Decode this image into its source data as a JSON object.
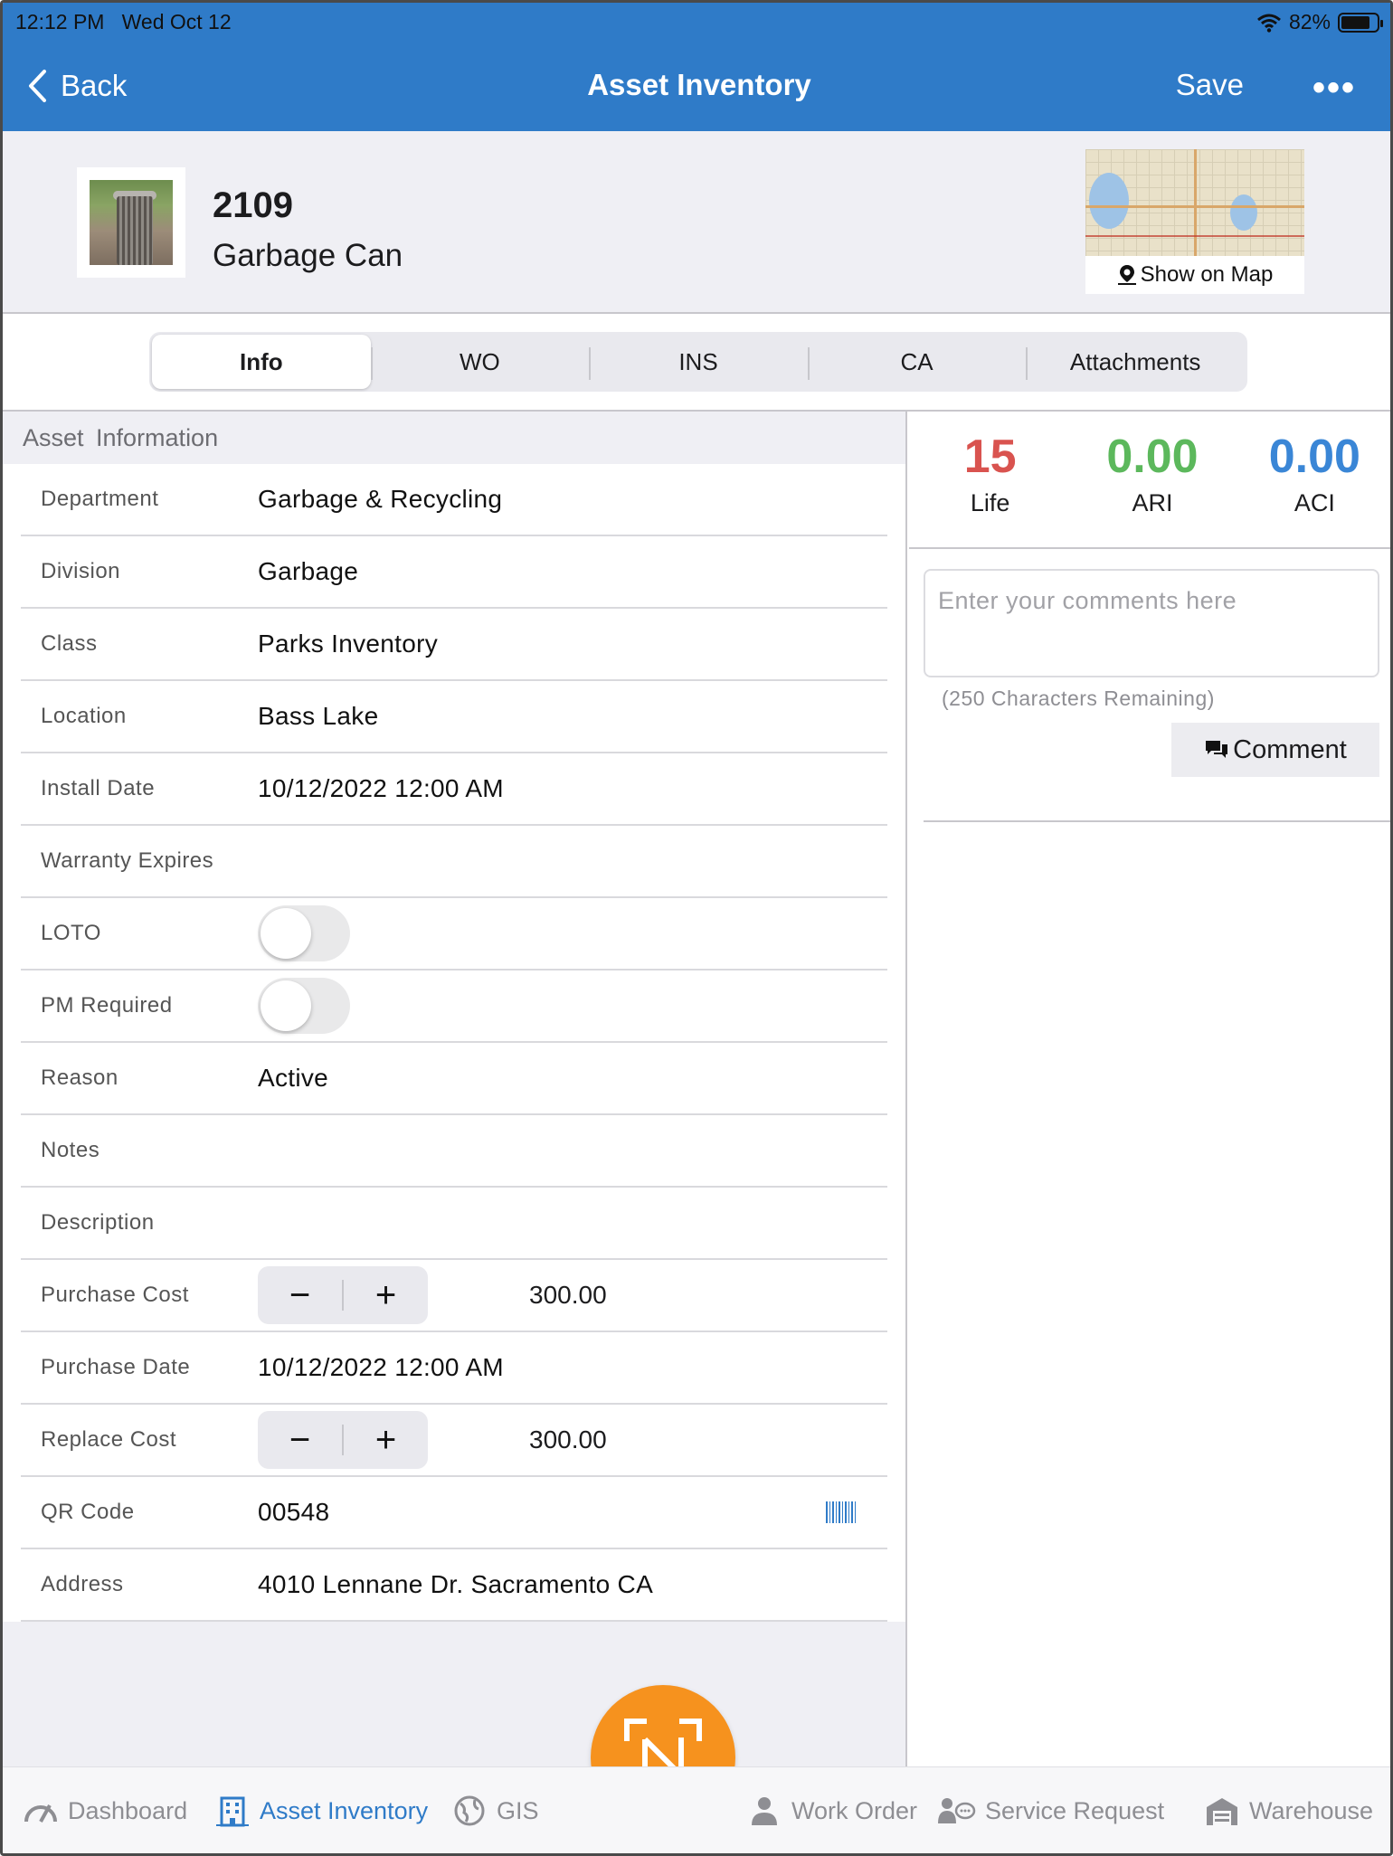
{
  "status_bar": {
    "time": "12:12 PM",
    "date": "Wed Oct 12",
    "battery": "82%",
    "battery_level": 0.82
  },
  "nav": {
    "back_label": "Back",
    "title": "Asset Inventory",
    "save_label": "Save",
    "more_label": "•••"
  },
  "asset": {
    "id": "2109",
    "name": "Garbage Can",
    "map_label": "Show on Map"
  },
  "tabs": [
    {
      "label": "Info",
      "active": true
    },
    {
      "label": "WO"
    },
    {
      "label": "INS"
    },
    {
      "label": "CA"
    },
    {
      "label": "Attachments"
    }
  ],
  "section_title": "Asset Information",
  "fields": {
    "department": {
      "label": "Department",
      "value": "Garbage & Recycling"
    },
    "division": {
      "label": "Division",
      "value": "Garbage"
    },
    "class": {
      "label": "Class",
      "value": "Parks Inventory"
    },
    "location": {
      "label": "Location",
      "value": "Bass Lake"
    },
    "install_date": {
      "label": "Install Date",
      "value": "10/12/2022 12:00 AM"
    },
    "warranty": {
      "label": "Warranty Expires",
      "value": ""
    },
    "loto": {
      "label": "LOTO",
      "on": false
    },
    "pm_required": {
      "label": "PM Required",
      "on": false
    },
    "reason": {
      "label": "Reason",
      "value": "Active"
    },
    "notes": {
      "label": "Notes",
      "value": ""
    },
    "description": {
      "label": "Description",
      "value": ""
    },
    "purchase_cost": {
      "label": "Purchase Cost",
      "value": "300.00",
      "minus": "−",
      "plus": "+"
    },
    "purchase_date": {
      "label": "Purchase Date",
      "value": "10/12/2022 12:00 AM"
    },
    "replace_cost": {
      "label": "Replace Cost",
      "value": "300.00",
      "minus": "−",
      "plus": "+"
    },
    "qr_code": {
      "label": "QR Code",
      "value": "00548"
    },
    "address": {
      "label": "Address",
      "value": "4010 Lennane Dr. Sacramento CA"
    }
  },
  "stats": [
    {
      "value": "15",
      "label": "Life",
      "color": "#d9534f"
    },
    {
      "value": "0.00",
      "label": "ARI",
      "color": "#5cb85c"
    },
    {
      "value": "0.00",
      "label": "ACI",
      "color": "#3a86d6"
    }
  ],
  "comments": {
    "placeholder": "Enter your comments here",
    "remaining": "(250 Characters Remaining)",
    "button_label": "Comment"
  },
  "bottom_tabs": [
    {
      "label": "Dashboard",
      "icon": "dashboard-gauge-icon"
    },
    {
      "label": "Asset Inventory",
      "icon": "building-icon",
      "active": true
    },
    {
      "label": "GIS",
      "icon": "globe-icon"
    },
    {
      "label": "Work Order",
      "icon": "worker-icon"
    },
    {
      "label": "Service Request",
      "icon": "chat-person-icon"
    },
    {
      "label": "Warehouse",
      "icon": "warehouse-icon"
    }
  ],
  "colors": {
    "accent": "#2f7bc8",
    "fab": "#f6921e"
  }
}
